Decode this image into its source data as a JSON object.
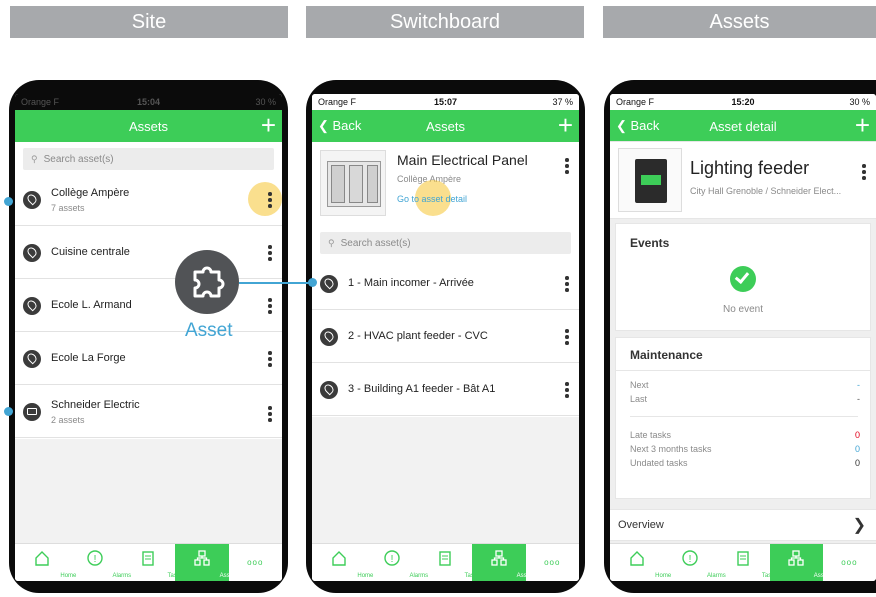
{
  "headers": {
    "site": "Site",
    "switchboard": "Switchboard",
    "assets": "Assets"
  },
  "status": {
    "phone1": {
      "carrier": "Orange F",
      "time": "15:04",
      "battery": "30 %"
    },
    "phone2": {
      "carrier": "Orange F",
      "time": "15:07",
      "battery": "37 %"
    },
    "phone3": {
      "carrier": "Orange F",
      "time": "15:20",
      "battery": "30 %"
    }
  },
  "site": {
    "title": "Assets",
    "search_placeholder": "Search asset(s)",
    "items": [
      {
        "label": "Collège Ampère",
        "sub": "7 assets",
        "icon": "location-pin-icon"
      },
      {
        "label": "Cuisine centrale",
        "sub": "",
        "icon": "location-pin-icon"
      },
      {
        "label": "Ecole L. Armand",
        "sub": "",
        "icon": "location-pin-icon"
      },
      {
        "label": "Ecole La Forge",
        "sub": "",
        "icon": "location-pin-icon"
      },
      {
        "label": "Schneider Electric",
        "sub": "2 assets",
        "icon": "folder-icon"
      }
    ]
  },
  "callout": {
    "label": "Asset"
  },
  "switchboard": {
    "back": "Back",
    "title": "Assets",
    "panel_name": "Main Electrical Panel",
    "panel_site": "Collège Ampère",
    "detail_link": "Go to asset detail",
    "search_placeholder": "Search asset(s)",
    "items": [
      {
        "label": "1 - Main incomer - Arrivée"
      },
      {
        "label": "2 - HVAC plant feeder - CVC"
      },
      {
        "label": "3 - Building A1 feeder - Bât A1"
      }
    ]
  },
  "detail": {
    "back": "Back",
    "title": "Asset detail",
    "asset_name": "Lighting feeder",
    "asset_path": "City Hall Grenoble / Schneider Elect...",
    "events_title": "Events",
    "no_event": "No event",
    "maintenance_title": "Maintenance",
    "next_label": "Next",
    "next_value": "-",
    "last_label": "Last",
    "last_value": "-",
    "late_label": "Late tasks",
    "late_value": "0",
    "next3_label": "Next 3 months tasks",
    "next3_value": "0",
    "undated_label": "Undated tasks",
    "undated_value": "0",
    "overview": "Overview"
  },
  "tabs": {
    "home": "Home",
    "alarms": "Alarms",
    "tasks": "Tasks",
    "assets": "Assets",
    "more": "ooo"
  },
  "colors": {
    "green": "#3dcd58",
    "blue": "#42a5d4",
    "red": "#e2001a",
    "header_grey": "#a7a9ac"
  }
}
